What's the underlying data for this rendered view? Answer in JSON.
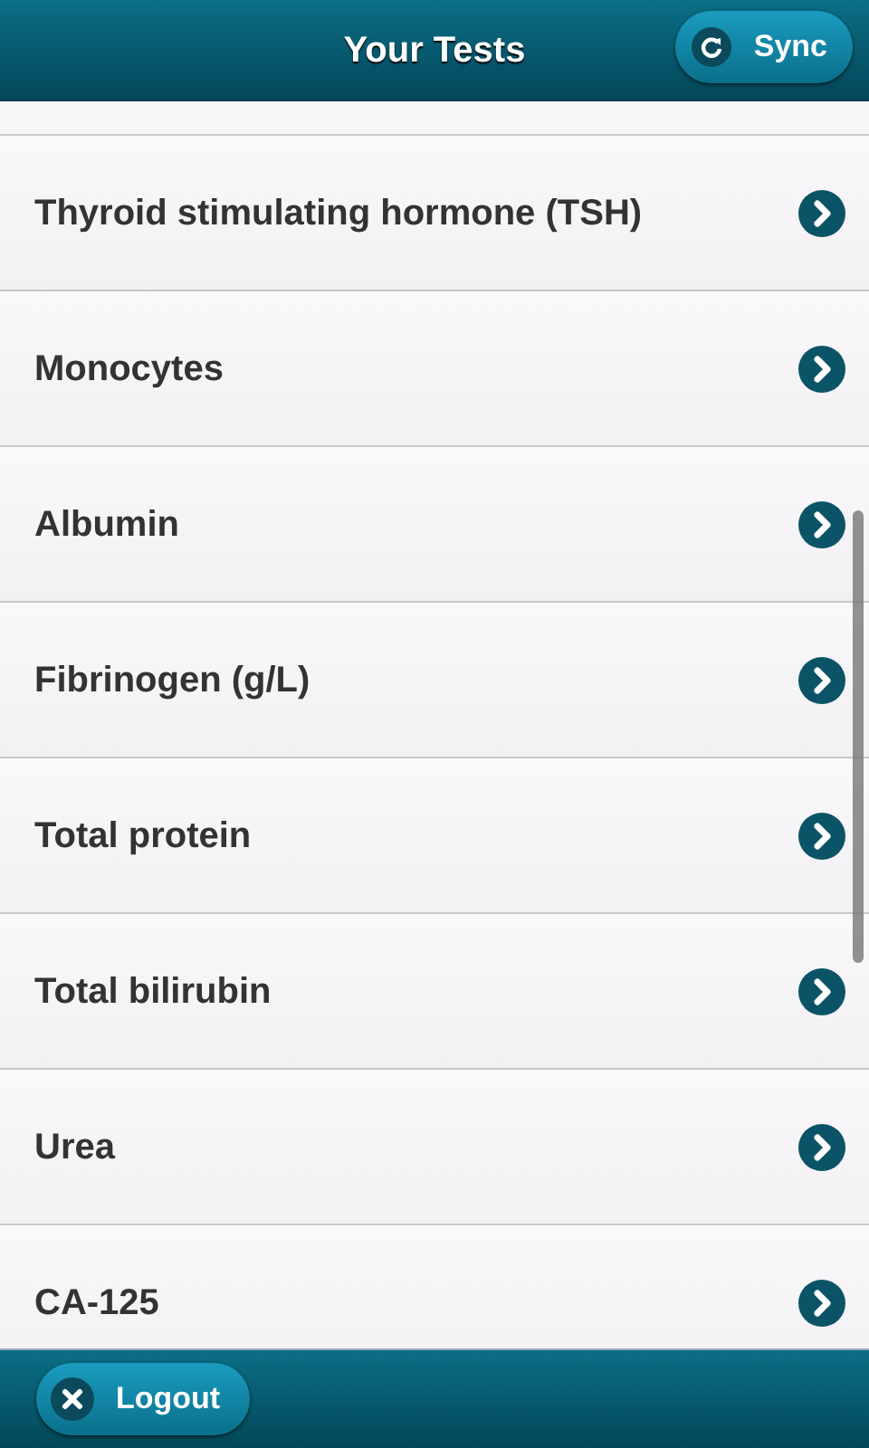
{
  "header": {
    "title": "Your Tests",
    "sync_button": "Sync"
  },
  "tests": [
    {
      "name": "Thyroid stimulating hormone (TSH)"
    },
    {
      "name": "Monocytes"
    },
    {
      "name": "Albumin"
    },
    {
      "name": "Fibrinogen (g/L)"
    },
    {
      "name": "Total protein"
    },
    {
      "name": "Total bilirubin"
    },
    {
      "name": "Urea"
    },
    {
      "name": "CA-125"
    }
  ],
  "footer": {
    "logout_button": "Logout"
  }
}
